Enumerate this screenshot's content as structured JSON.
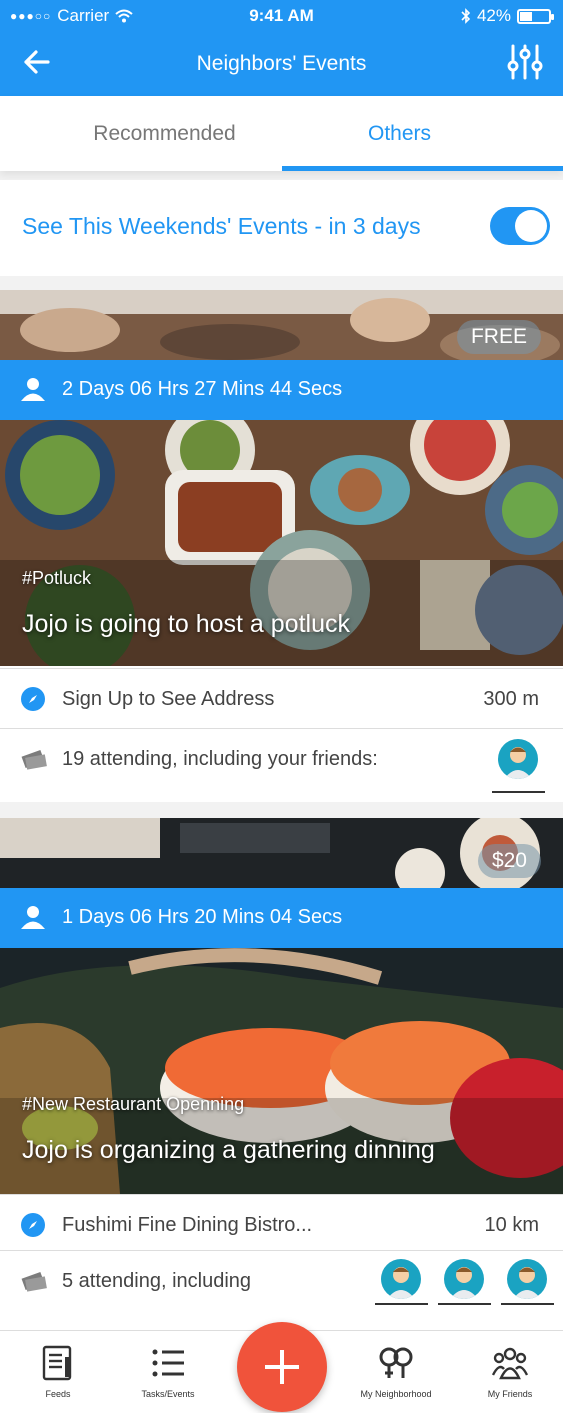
{
  "status_bar": {
    "carrier": "Carrier",
    "time": "9:41 AM",
    "battery": "42%",
    "battery_level": 0.42
  },
  "header": {
    "title": "Neighbors' Events",
    "back_icon": "arrow-left-icon",
    "filter_icon": "sliders-icon"
  },
  "tabs": [
    {
      "label": "Recommended",
      "active": false
    },
    {
      "label": "Others",
      "active": true
    }
  ],
  "weekend_toggle": {
    "label": "See This Weekends' Events - in 3 days",
    "on": true
  },
  "events": [
    {
      "price": "FREE",
      "countdown": "2 Days 06 Hrs 27 Mins 44 Secs",
      "tag": "#Potluck",
      "headline": "Jojo is going to host a potluck",
      "address": "Sign Up to See Address",
      "distance": "300 m",
      "attending": "19 attending, including your friends:"
    },
    {
      "price": "$20",
      "countdown": "1 Days 06 Hrs 20 Mins 04 Secs",
      "tag": "#New Restaurant Openning",
      "headline": "Jojo is organizing a gathering dinning",
      "address": "Fushimi Fine Dining Bistro...",
      "distance": "10 km",
      "attending": "5 attending, including"
    }
  ],
  "bottom_nav": [
    {
      "label": "Feeds",
      "icon": "feeds-icon"
    },
    {
      "label": "Tasks/Events",
      "icon": "list-icon"
    },
    {
      "label": "My Neighborhood",
      "icon": "neighborhood-icon"
    },
    {
      "label": "My Friends",
      "icon": "friends-icon"
    }
  ],
  "colors": {
    "primary": "#2196f3",
    "fab": "#f0533b"
  }
}
